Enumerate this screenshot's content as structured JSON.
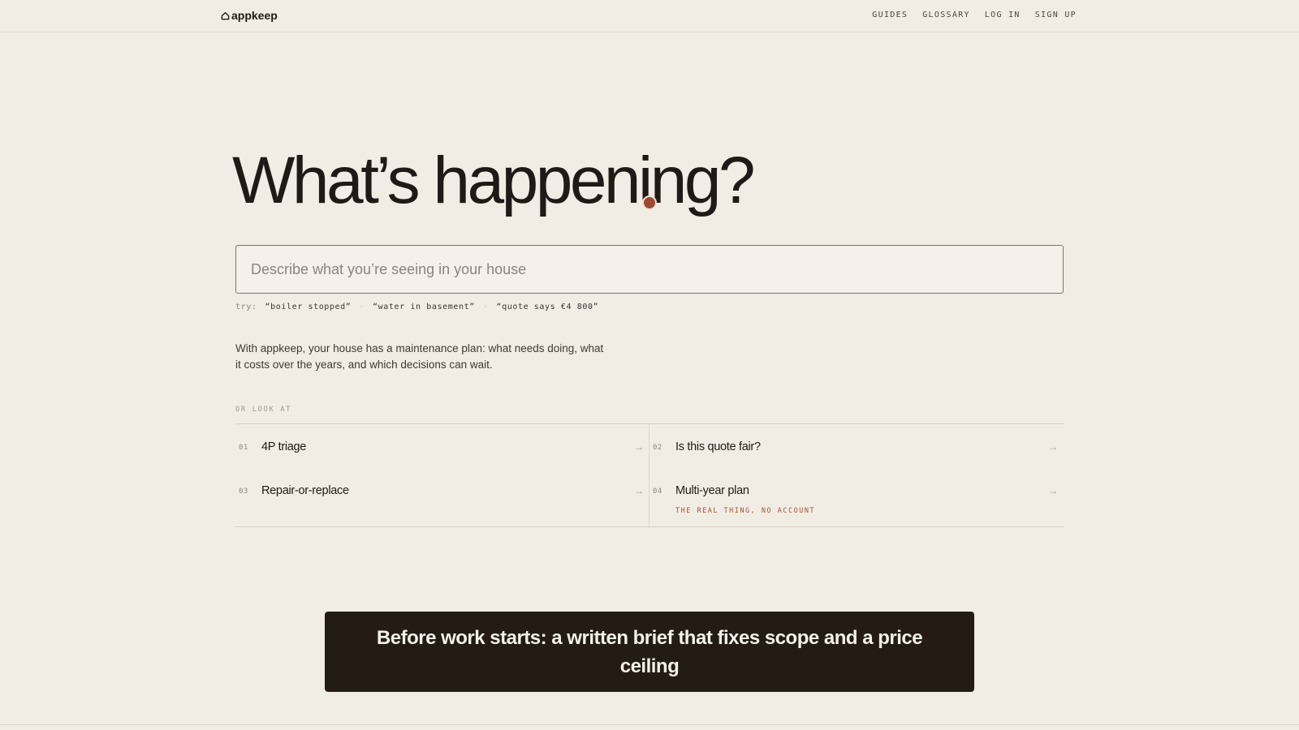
{
  "brand": {
    "name": "appkeep",
    "icon": "house-icon"
  },
  "nav": {
    "items": [
      "GUIDES",
      "GLOSSARY",
      "LOG IN",
      "SIGN UP"
    ]
  },
  "hero": {
    "headline": "What’s happening?"
  },
  "search": {
    "placeholder": "Describe what you’re seeing in your house",
    "value": ""
  },
  "suggestions": {
    "label": "try:",
    "chips": [
      "“boiler stopped”",
      "“water in basement”",
      "“quote says €4 800”"
    ]
  },
  "intro": {
    "text": "With appkeep, your house has a maintenance plan: what needs doing, what it costs over the years, and which decisions can wait."
  },
  "tools": {
    "label": "OR LOOK AT",
    "items": [
      {
        "num": "01",
        "title": "4P triage",
        "arrow": "→"
      },
      {
        "num": "02",
        "title": "Is this quote fair?",
        "arrow": "→"
      },
      {
        "num": "03",
        "title": "Repair-or-replace",
        "arrow": "→"
      },
      {
        "num": "04",
        "title": "Multi-year plan",
        "subtitle": "THE REAL THING, NO ACCOUNT",
        "arrow": "→"
      }
    ]
  },
  "banner": {
    "text": "Before work starts: a written brief that fixes scope and a price ceiling"
  },
  "colors": {
    "background": "#f2ede4",
    "ink": "#1f1a16",
    "accent": "#9c4a2f",
    "banner_bg": "#231b14"
  }
}
